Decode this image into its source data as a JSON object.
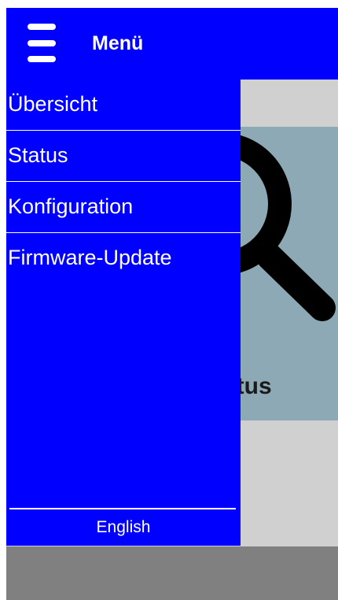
{
  "header": {
    "menu_icon": "hamburger-icon",
    "title": "Menü"
  },
  "drawer": {
    "items": [
      {
        "label": "Übersicht"
      },
      {
        "label": "Status"
      },
      {
        "label": "Konfiguration"
      },
      {
        "label": "Firmware-Update"
      }
    ],
    "language": "English"
  },
  "background": {
    "tile_icon": "magnifier-icon",
    "tile_label": "Status"
  },
  "colors": {
    "primary": "#0000ff",
    "tile": "#8ea9b6",
    "page_bg": "#d0d0d0",
    "footer": "#808080"
  }
}
